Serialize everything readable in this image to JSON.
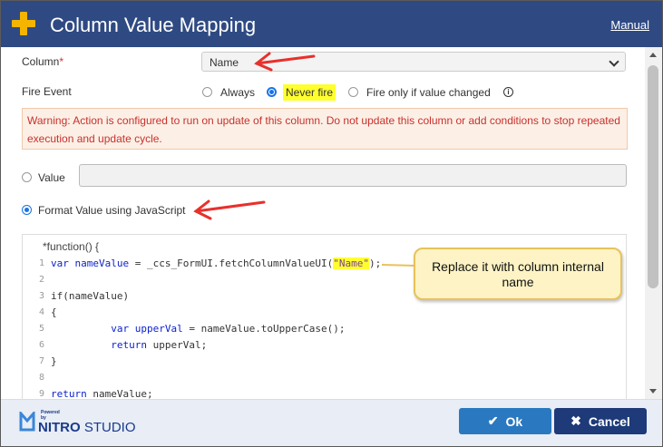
{
  "window": {
    "title": "Column Value Mapping",
    "manual_link": "Manual"
  },
  "form": {
    "column_label": "Column",
    "required_marker": "*",
    "column_value": "Name",
    "fire_event_label": "Fire Event",
    "fire_event_options": [
      "Always",
      "Never fire",
      "Fire only if value changed"
    ],
    "fire_event_selected": "Never fire",
    "info_glyph": "i",
    "warning": "Warning: Action is configured to run on update of this column. Do not update this column or add conditions to stop repeated execution and update cycle.",
    "value_option_label": "Value",
    "js_option_label": "Format Value using JavaScript",
    "selected_mode": "Format Value using JavaScript"
  },
  "editor": {
    "header": "*function() {",
    "line_numbers": [
      "1",
      "2",
      "3",
      "4",
      "5",
      "6",
      "7",
      "8",
      "9"
    ],
    "lines": [
      "var nameValue = _ccs_FormUI.fetchColumnValueUI(\"Name\");",
      "",
      "if(nameValue)",
      "{",
      "          var upperVal = nameValue.toUpperCase();",
      "          return upperVal;",
      "}",
      "",
      "return nameValue;"
    ]
  },
  "callout": {
    "text": "Replace it with column internal name"
  },
  "footer": {
    "logo_powered": "Powered by",
    "logo_brand": "NITRO",
    "logo_product": "STUDIO",
    "ok_label": "Ok",
    "cancel_label": "Cancel"
  },
  "colors": {
    "titlebar": "#2f4a83",
    "accent_yellow": "#f4b400",
    "highlight": "#ffff2e",
    "warning_text": "#c9302c",
    "ok_button": "#2a79c0",
    "cancel_button": "#1e3a78",
    "annotation_arrow": "#e8302c"
  }
}
